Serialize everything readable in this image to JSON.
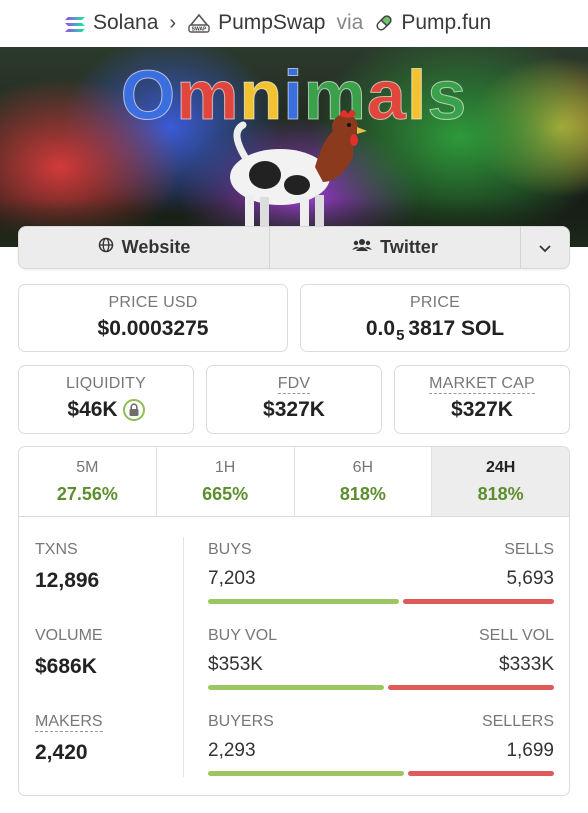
{
  "breadcrumb": {
    "chain": "Solana",
    "dex": "PumpSwap",
    "via": "via",
    "launchpad": "Pump.fun"
  },
  "banner": {
    "title": "Omnimals",
    "letters": [
      {
        "ch": "O",
        "color": "#3b6fe0"
      },
      {
        "ch": "m",
        "color": "#e0463b"
      },
      {
        "ch": "n",
        "color": "#f2c230"
      },
      {
        "ch": "i",
        "color": "#3b6fe0"
      },
      {
        "ch": "m",
        "color": "#3aa04a"
      },
      {
        "ch": "a",
        "color": "#e0463b"
      },
      {
        "ch": "l",
        "color": "#f2c230"
      },
      {
        "ch": "s",
        "color": "#3aa04a"
      }
    ]
  },
  "links": {
    "website": "Website",
    "twitter": "Twitter"
  },
  "price_usd": {
    "label": "PRICE USD",
    "value": "$0.0003275"
  },
  "price_sol": {
    "label": "PRICE",
    "prefix": "0.0",
    "subscript": "5",
    "rest": "3817 SOL"
  },
  "liquidity": {
    "label": "LIQUIDITY",
    "value": "$46K"
  },
  "fdv": {
    "label": "FDV",
    "value": "$327K"
  },
  "market_cap": {
    "label": "MARKET CAP",
    "value": "$327K"
  },
  "tabs": [
    {
      "label": "5M",
      "value": "27.56%",
      "active": false
    },
    {
      "label": "1H",
      "value": "665%",
      "active": false
    },
    {
      "label": "6H",
      "value": "818%",
      "active": false
    },
    {
      "label": "24H",
      "value": "818%",
      "active": true
    }
  ],
  "stats": {
    "txns": {
      "label": "TXNS",
      "value": "12,896"
    },
    "volume": {
      "label": "VOLUME",
      "value": "$686K"
    },
    "makers": {
      "label": "MAKERS",
      "value": "2,420"
    },
    "buys": {
      "left_label": "BUYS",
      "right_label": "SELLS",
      "left_value": "7,203",
      "right_value": "5,693",
      "left_share": 0.559
    },
    "vol": {
      "left_label": "BUY VOL",
      "right_label": "SELL VOL",
      "left_value": "$353K",
      "right_value": "$333K",
      "left_share": 0.515
    },
    "users": {
      "left_label": "BUYERS",
      "right_label": "SELLERS",
      "left_value": "2,293",
      "right_value": "1,699",
      "left_share": 0.574
    }
  },
  "colors": {
    "positive": "#5d8e2e",
    "buy_bar": "#9cc760",
    "sell_bar": "#e05a5a"
  }
}
